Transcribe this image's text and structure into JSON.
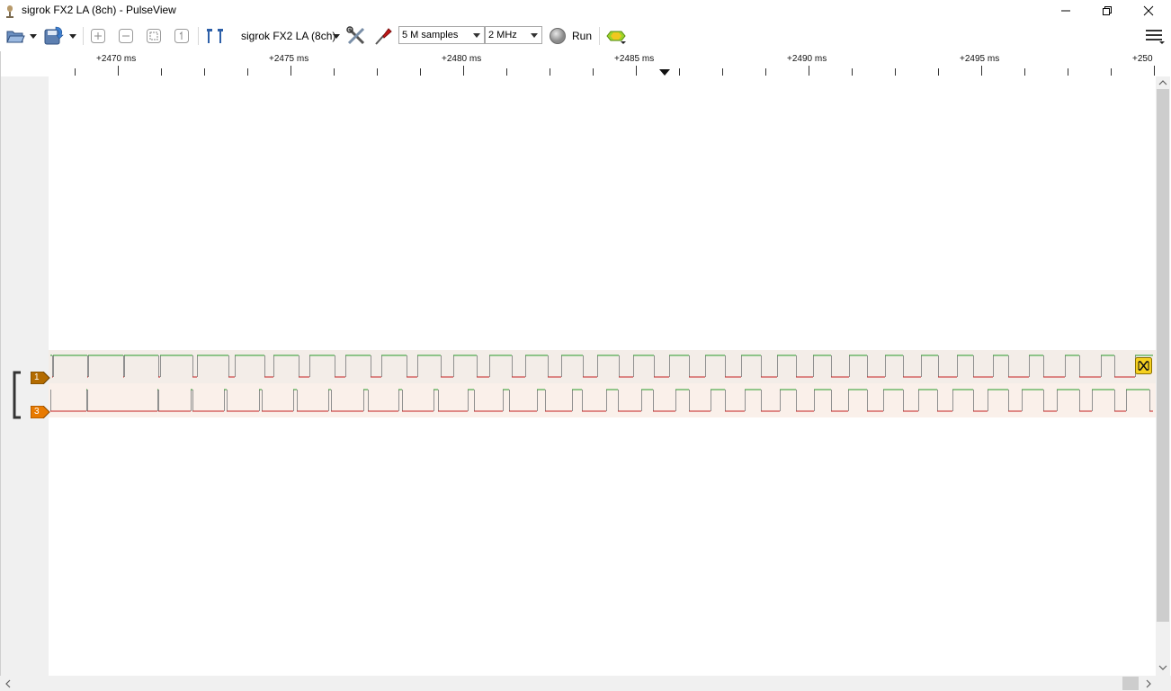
{
  "window": {
    "title": "sigrok FX2 LA (8ch) - PulseView"
  },
  "toolbar": {
    "device_name": "sigrok FX2 LA (8ch)",
    "sample_count": "5 M samples",
    "sample_rate": "2 MHz",
    "run_label": "Run",
    "icons": [
      "open-icon",
      "save-icon",
      "zoom-in-icon",
      "zoom-out-icon",
      "zoom-fit-icon",
      "zoom-one-to-one-icon",
      "cursor-icon",
      "device-config-icon",
      "probe-icon",
      "run-icon",
      "decoder-icon",
      "menu-icon"
    ]
  },
  "ruler": {
    "labels": [
      "+2470 ms",
      "+2475 ms",
      "+2480 ms",
      "+2485 ms",
      "+2490 ms",
      "+2495 ms",
      "+250"
    ]
  },
  "channels": [
    {
      "id": "1",
      "label": "1",
      "color": "#b36b00"
    },
    {
      "id": "3",
      "label": "3",
      "color": "#e87a00"
    }
  ],
  "colors": {
    "signal_high": "#2a9c2a",
    "signal_low": "#c42020",
    "edge": "#909090",
    "trace1_bg": "#f3ede8",
    "trace3_bg": "#faf0ea",
    "trigger_badge": "#f5d020"
  }
}
